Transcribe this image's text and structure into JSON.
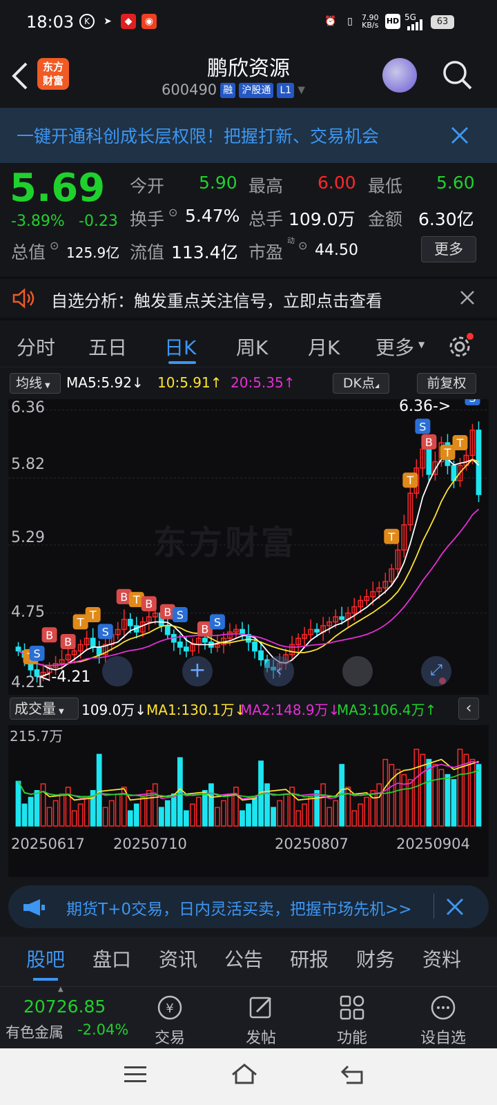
{
  "status": {
    "time": "18:03",
    "speed": "7.90",
    "speed_unit": "KB/s",
    "net": "5G",
    "battery": "63"
  },
  "header": {
    "logo_line1": "东方",
    "logo_line2": "财富",
    "title": "鹏欣资源",
    "code": "600490",
    "tag_rong": "融",
    "tag_hgt": "沪股通",
    "tag_l1": "L1"
  },
  "banner1": {
    "text": "一键开通科创成长层权限！把握打新、交易机会"
  },
  "quote": {
    "price": "5.69",
    "pct": "-3.89%",
    "chg": "-0.23",
    "open_label": "今开",
    "open": "5.90",
    "high_label": "最高",
    "high": "6.00",
    "low_label": "最低",
    "low": "5.60",
    "turnover_label": "换手",
    "turnover": "5.47%",
    "vol_label": "总手",
    "vol": "109.0万",
    "amt_label": "金额",
    "amt": "6.30亿",
    "mcap_label": "总值",
    "mcap": "125.9亿",
    "float_label": "流值",
    "float": "113.4亿",
    "pe_label": "市盈",
    "pe_sup": "动",
    "pe": "44.50",
    "more": "更多"
  },
  "alert": {
    "text": "自选分析：触发重点关注信号，立即点击查看"
  },
  "tabs": [
    "分时",
    "五日",
    "日K",
    "周K",
    "月K",
    "更多"
  ],
  "ma": {
    "selector": "均线",
    "ma5": "MA5:5.92",
    "ma10": "10:5.91",
    "ma20": "20:5.35",
    "dk": "DK点",
    "fq": "前复权"
  },
  "kaxis": [
    "6.36",
    "5.82",
    "5.29",
    "4.75",
    "4.21"
  ],
  "annot": {
    "high": "6.36->",
    "low": "<-4.21"
  },
  "vol": {
    "selector": "成交量",
    "cur": "109.0万",
    "ma1": "MA1:130.1万",
    "ma2": "MA2:148.9万",
    "ma3": "MA3:106.4万",
    "max": "215.7万"
  },
  "dates": [
    "20250617",
    "20250710",
    "20250807",
    "20250904"
  ],
  "watermark": "东方财富",
  "banner2": {
    "text": "期货T+0交易，日内灵活买卖，把握市场先机>>"
  },
  "subtabs": [
    "股吧",
    "盘口",
    "资讯",
    "公告",
    "研报",
    "财务",
    "资料"
  ],
  "bottom": {
    "index_value": "20726.85",
    "index_name": "有色金属",
    "index_pct": "-2.04%",
    "trade": "交易",
    "post": "发帖",
    "func": "功能",
    "addfav": "设自选"
  },
  "colors": {
    "up": "#ff2828",
    "down": "#1fd12d",
    "bg": "#15161a",
    "accent": "#2f8df5"
  },
  "chart_data": {
    "type": "candlestick",
    "ylim": [
      4.21,
      6.36
    ],
    "closes": [
      4.45,
      4.4,
      4.3,
      4.25,
      4.28,
      4.32,
      4.35,
      4.38,
      4.42,
      4.45,
      4.5,
      4.55,
      4.48,
      4.42,
      4.5,
      4.58,
      4.62,
      4.7,
      4.65,
      4.6,
      4.68,
      4.72,
      4.75,
      4.65,
      4.58,
      4.52,
      4.48,
      4.45,
      4.5,
      4.55,
      4.52,
      4.48,
      4.5,
      4.55,
      4.6,
      4.62,
      4.58,
      4.52,
      4.45,
      4.38,
      4.32,
      4.3,
      4.35,
      4.42,
      4.5,
      4.55,
      4.58,
      4.62,
      4.6,
      4.65,
      4.68,
      4.72,
      4.7,
      4.75,
      4.8,
      4.85,
      4.88,
      4.92,
      4.95,
      5.0,
      5.1,
      5.25,
      5.45,
      5.7,
      5.9,
      6.05,
      5.85,
      5.95,
      6.1,
      5.92,
      5.8,
      5.92,
      6.0,
      6.2,
      5.69
    ]
  }
}
